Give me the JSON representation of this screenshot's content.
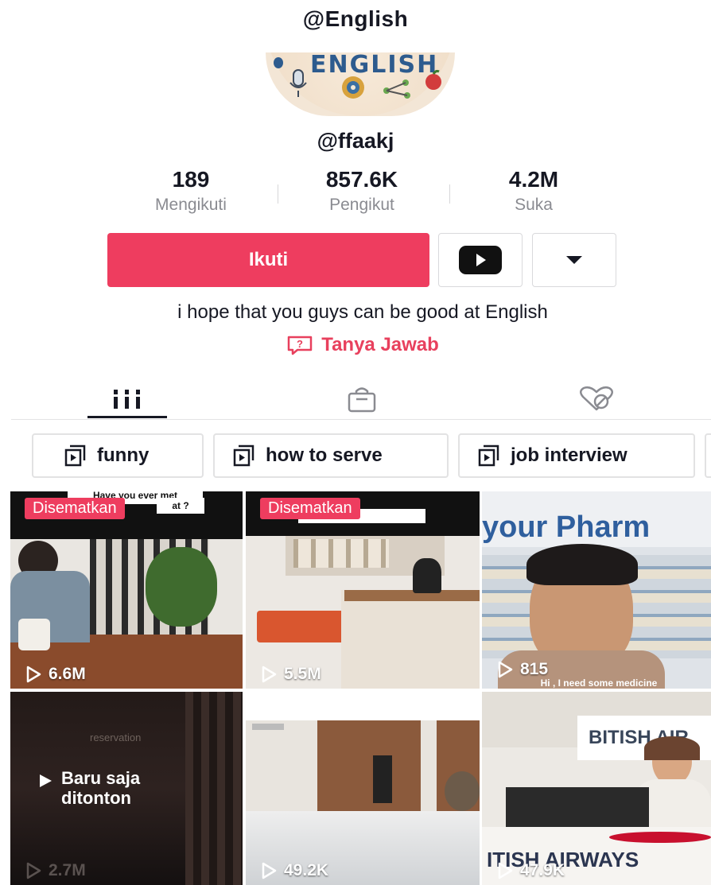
{
  "header": {
    "title": "@English"
  },
  "profile": {
    "avatar_text": "ENGLISH",
    "username": "@ffaakj",
    "bio": "i hope that you guys can be good at English",
    "qa_label": "Tanya Jawab"
  },
  "stats": [
    {
      "value": "189",
      "label": "Mengikuti"
    },
    {
      "value": "857.6K",
      "label": "Pengikut"
    },
    {
      "value": "4.2M",
      "label": "Suka"
    }
  ],
  "actions": {
    "follow_label": "Ikuti",
    "youtube_icon": "youtube-icon",
    "more_icon": "caret-down-icon"
  },
  "tabs": [
    {
      "icon": "grid-icon",
      "active": true
    },
    {
      "icon": "shop-bag-icon",
      "active": false
    },
    {
      "icon": "liked-hidden-icon",
      "active": false
    }
  ],
  "playlists": [
    "funny",
    "how to serve",
    "job interview"
  ],
  "videos": [
    {
      "badge": "Disematkan",
      "views": "6.6M",
      "overlay_text": "Have you ever met",
      "overlay_text2": "at ?"
    },
    {
      "badge": "Disematkan",
      "views": "5.5M"
    },
    {
      "views": "815",
      "overlay_text": "your Pharm",
      "caption": "Hi , I need some medicine"
    },
    {
      "views": "2.7M",
      "overlay_text": "reservation",
      "status": "Baru saja ditonton"
    },
    {
      "views": "49.2K"
    },
    {
      "views": "47.9K",
      "overlay_text": "BITISH AIR",
      "overlay_text2": "ITISH AIRWAYS"
    }
  ],
  "colors": {
    "accent": "#ee3d5f",
    "text": "#161823",
    "muted": "#8a8b91"
  }
}
